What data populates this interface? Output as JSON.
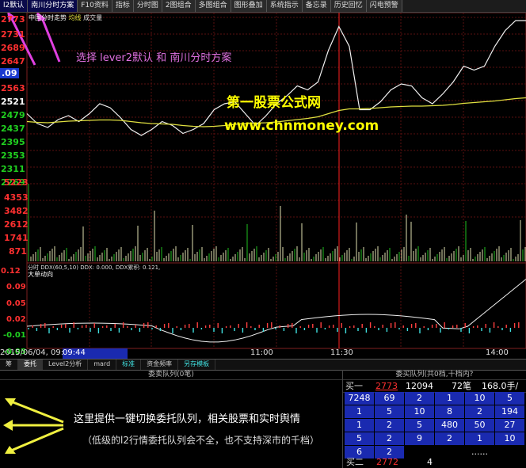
{
  "toolbar": {
    "items": [
      "l2默认",
      "南川分时方案",
      "F10资料",
      "指标",
      "分时图",
      "2图组合",
      "多图组合",
      "图形叠加",
      "系统指示",
      "备忘录",
      "历史回忆",
      "闪电预警"
    ]
  },
  "legend": {
    "line1": "中国分时走势",
    "line2": "均线",
    "line3": "成交量"
  },
  "price_labels": [
    "2773",
    "2731",
    "2689",
    "2647",
    "2605",
    "2563",
    "2521",
    "2479",
    "2437",
    "2395",
    "2353",
    "2311",
    "2269"
  ],
  "current_price_tag": ".09",
  "volume_labels": [
    "5223",
    "4353",
    "3482",
    "2612",
    "1741",
    "871"
  ],
  "volume_header": "分时 DDX(60,5,10) DDX: 0.000, DDX累积: 0.121,",
  "ddx_labels": [
    "0.12",
    "0.09",
    "0.05",
    "0.02",
    "-0.01",
    "-0.05"
  ],
  "ddx_title": "大单动向",
  "time": {
    "date_label": "2015/06/04, 09:30",
    "cursor_time": "09:44",
    "ticks": [
      "11:00",
      "11:30",
      "14:00"
    ]
  },
  "watermark": {
    "line1": "第一股票公式网",
    "line2": "www.chnmoney.com"
  },
  "annotations": {
    "top": "选择 lever2默认  和 南川分时方案",
    "bottom1": "这里提供一键切换委托队列，相关股票和实时舆情",
    "bottom2": "（低级的l2行情委托队列会不全，也不支持深市的千档）"
  },
  "tabs": [
    "筹",
    "委托",
    "Level2分析",
    "mard",
    "标准",
    "资金频率",
    "另存模板"
  ],
  "queue": {
    "sell_title": "委卖队列(0笔)",
    "buy_title": "委买队列(共0档,十档内?",
    "buy1": {
      "label": "买一",
      "price": "2773",
      "vol": "12094",
      "count": "72笔",
      "hands": "168.0手/笔"
    },
    "rows": [
      [
        "7248",
        "69",
        "2",
        "1",
        "10",
        "5"
      ],
      [
        "1",
        "5",
        "10",
        "8",
        "2",
        "194"
      ],
      [
        "1",
        "2",
        "5",
        "480",
        "50",
        "27"
      ],
      [
        "5",
        "2",
        "9",
        "2",
        "1",
        "10"
      ],
      [
        "6",
        "2",
        "",
        "",
        "......",
        ""
      ]
    ],
    "buy2": {
      "label": "买二",
      "price": "2772",
      "vol": "4"
    }
  },
  "chart_data": {
    "type": "line",
    "title": "",
    "price_axis": [
      2269,
      2773
    ],
    "series": [
      {
        "name": "",
        "values": [
          2530,
          2505,
          2495,
          2515,
          2525,
          2510,
          2530,
          2555,
          2545,
          2520,
          2490,
          2475,
          2490,
          2510,
          2500,
          2480,
          2490,
          2505,
          2540,
          2555,
          2560,
          2530,
          2500,
          2525,
          2555,
          2575,
          2600,
          2590,
          2610,
          2690,
          2750,
          2700,
          2540,
          2540,
          2560,
          2590,
          2605,
          2600,
          2570,
          2555,
          2580,
          2610,
          2650,
          2640,
          2650,
          2700,
          2740,
          2765,
          2765
        ]
      },
      {
        "name": "",
        "values": [
          2510,
          2508,
          2507,
          2509,
          2511,
          2512,
          2513,
          2514,
          2514,
          2513,
          2510,
          2507,
          2505,
          2504,
          2503,
          2500,
          2498,
          2497,
          2498,
          2500,
          2503,
          2505,
          2506,
          2507,
          2509,
          2512,
          2515,
          2518,
          2522,
          2530,
          2538,
          2542,
          2542,
          2543,
          2545,
          2547,
          2548,
          2549,
          2549,
          2550,
          2551,
          2553,
          2556,
          2558,
          2560,
          2562,
          2565,
          2568,
          2570
        ]
      }
    ]
  }
}
